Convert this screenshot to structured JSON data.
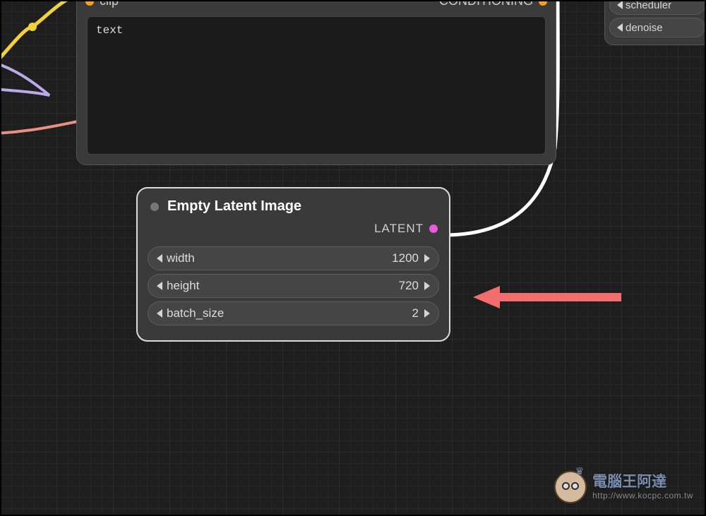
{
  "top_node": {
    "input_label": "clip",
    "output_label": "CONDITIONING",
    "textarea_value": "text"
  },
  "sampler": {
    "items": [
      "scheduler",
      "denoise"
    ]
  },
  "latent_node": {
    "title": "Empty Latent Image",
    "output_label": "LATENT",
    "params": [
      {
        "name": "width",
        "value": "1200"
      },
      {
        "name": "height",
        "value": "720"
      },
      {
        "name": "batch_size",
        "value": "2"
      }
    ]
  },
  "watermark": {
    "title": "電腦王阿達",
    "url": "http://www.kocpc.com.tw"
  },
  "colors": {
    "port_orange": "#ff9d1f",
    "port_pink": "#e85bdc",
    "arrow": "#f26d6d"
  }
}
